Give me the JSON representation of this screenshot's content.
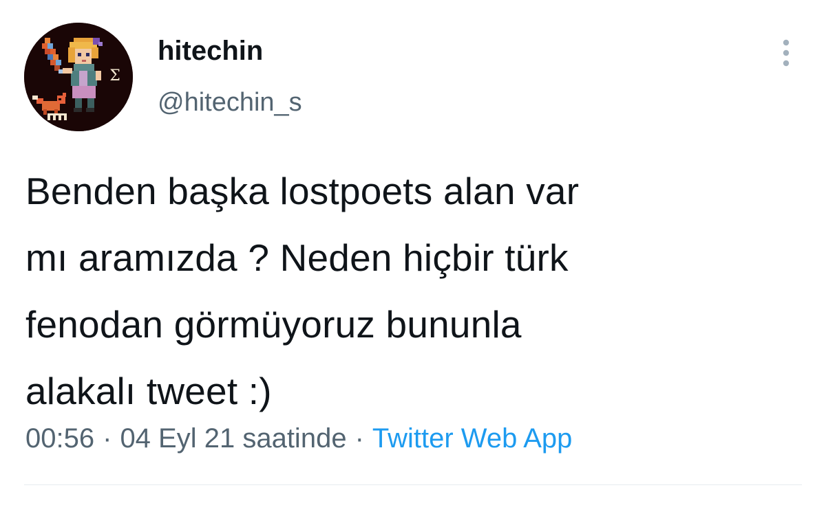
{
  "user": {
    "display_name": "hitechin",
    "handle": "@hitechin_s"
  },
  "tweet": {
    "text_lines": [
      "Benden başka lostpoets alan var",
      "mı aramızda ? Neden hiçbir türk",
      "fenodan görmüyoruz bununla",
      "alakalı tweet :)"
    ],
    "time": "00:56",
    "separator": "·",
    "date": "04 Eyl 21 saatinde",
    "source": "Twitter Web App"
  },
  "icons": {
    "more": "more-vertical-icon",
    "avatar": "pixel-art-avatar"
  },
  "colors": {
    "text": "#0f1419",
    "secondary": "#536471",
    "link": "#1d9bf0",
    "divider": "#e6ecf0"
  }
}
